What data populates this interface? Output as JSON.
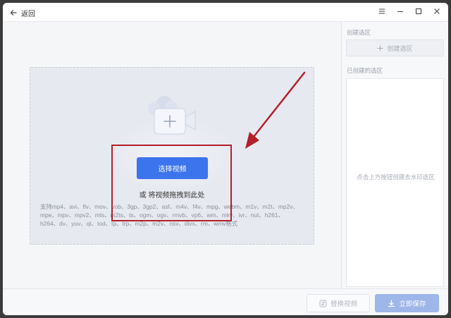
{
  "titlebar": {
    "back_label": "返回",
    "controls": [
      "menu-icon",
      "minimize-icon",
      "maximize-icon",
      "close-icon"
    ]
  },
  "dropzone": {
    "select_button": "选择视频",
    "drag_hint": "或 将视频拖拽到此处",
    "formats": "支持mp4、avi、flv、mov、vob、3gp、3gp2、asf、m4v、f4v、mpg、webm、m1v、m2t、mp2v、mpe、mpv、mpv2、mts、m2ts、ts、ogm、ogv、rmvb、vp6、wm、mkv、ivr、nut、h261、h264、dv、yuv、qt、tod、tp、trp、m2p、m2v、nsv、divx、rm、wmv格式"
  },
  "sidebar": {
    "create_label": "创建选区",
    "create_button": "创建选区",
    "created_label": "已创建的选区",
    "empty_hint": "点击上方按钮创建去水印选区"
  },
  "footer": {
    "replace_button": "替换视频",
    "save_button": "立即保存"
  },
  "colors": {
    "accent": "#3b74ec",
    "annotation": "#b3202a",
    "save_disabled": "#9fb6e9"
  }
}
